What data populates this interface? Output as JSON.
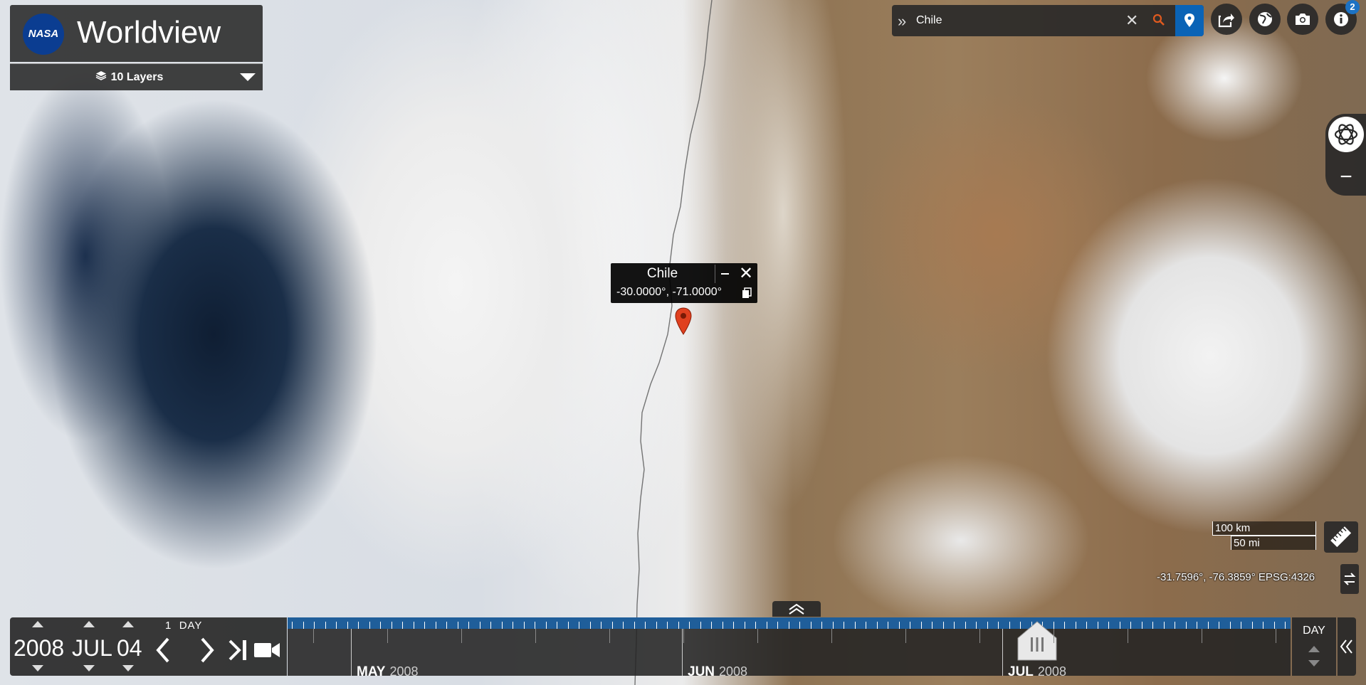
{
  "app": {
    "title": "Worldview",
    "nasa_logo_text": "NASA"
  },
  "layers": {
    "label": "10 Layers"
  },
  "search": {
    "value": "Chile"
  },
  "toolbar": {
    "info_badge": "2"
  },
  "popup": {
    "title": "Chile",
    "coordinates": "-30.0000°, -71.0000°"
  },
  "scale": {
    "km": "100 km",
    "mi": "50 mi"
  },
  "coordinates_readout": "-31.7596°, -76.3859° EPSG:4326",
  "timeline": {
    "year": "2008",
    "month": "JUL",
    "day": "04",
    "interval_count": "1",
    "interval_unit": "DAY",
    "zoom_level": "DAY",
    "months": [
      {
        "name": "MAY",
        "year": "2008"
      },
      {
        "name": "JUN",
        "year": "2008"
      },
      {
        "name": "JUL",
        "year": "2008"
      }
    ]
  },
  "colors": {
    "accent": "#0a63b6",
    "marker": "#e0401f",
    "panel": "#282828",
    "tick_strip": "#1f5e9a"
  }
}
